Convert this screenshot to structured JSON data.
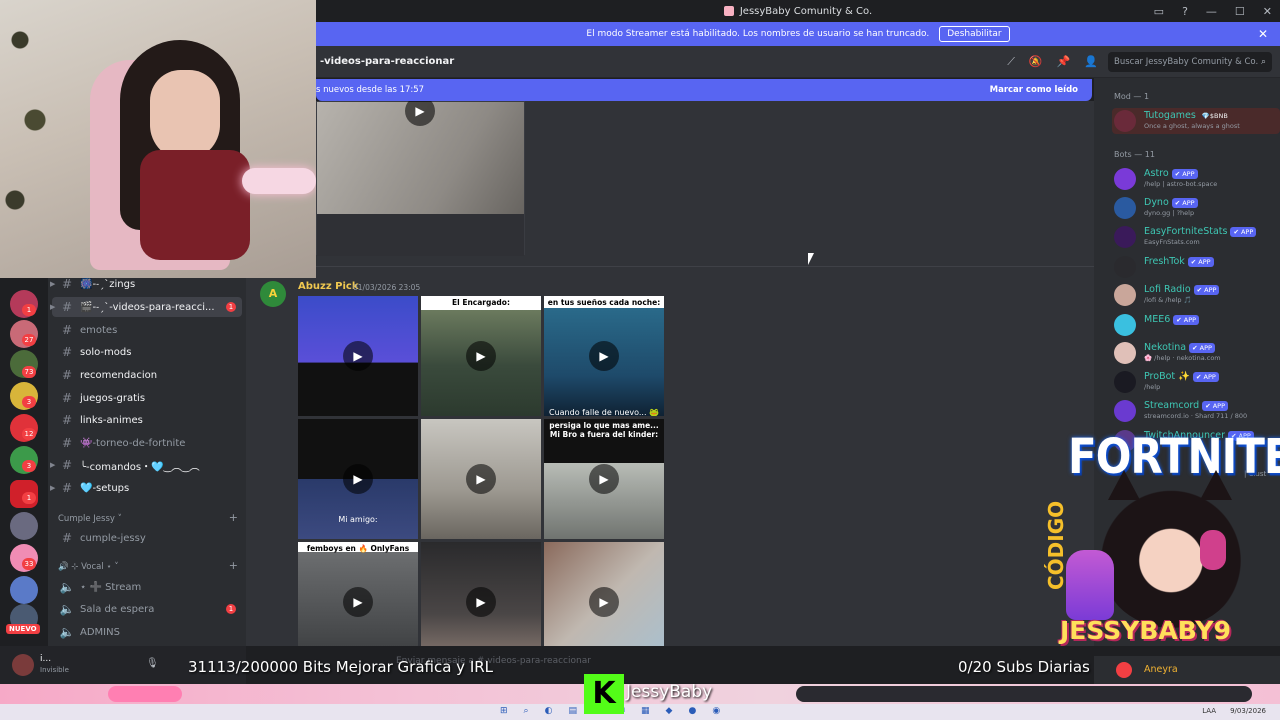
{
  "window": {
    "title": "JessyBaby Comunity & Co.",
    "controls": [
      "▭",
      "?",
      "—",
      "☐",
      "✕"
    ]
  },
  "streamer_bar": {
    "message": "El modo Streamer está habilitado. Los nombres de usuario se han truncado.",
    "button": "Deshabilitar",
    "close": "✕"
  },
  "channel_header": {
    "name": "-videos-para-reaccionar",
    "search_placeholder": "Buscar JessyBaby Comunity & Co."
  },
  "new_messages": {
    "text": "s nuevos desde las 17:57",
    "mark_read": "Marcar como leído"
  },
  "server_rail": {
    "badges": [
      "1",
      "27",
      "73",
      "3",
      "12",
      "3",
      "1",
      "33"
    ],
    "nuevo": "NUEVO"
  },
  "channels": [
    {
      "label": "🎆-˗ˏˋzings",
      "icon": "#"
    },
    {
      "label": "🎬-˗ˏˋ-videos-para-reacci...",
      "icon": "#",
      "unread": "1"
    },
    {
      "label": "emotes",
      "icon": "#"
    },
    {
      "label": "solo-mods",
      "icon": "#"
    },
    {
      "label": "recomendacion",
      "icon": "#"
    },
    {
      "label": "juegos-gratis",
      "icon": "#"
    },
    {
      "label": "links-animes",
      "icon": "#"
    },
    {
      "label": "👾-torneo-de-fortnite",
      "icon": "#"
    },
    {
      "label": "╰-comandos・🩵‿︵‿︵",
      "icon": "#"
    },
    {
      "label": "🩵-setups",
      "icon": "#"
    }
  ],
  "categories": {
    "cumple": "Cumple Jessy ˅",
    "cumple_channel": "cumple-jessy",
    "vocal": "🔊 ⊹ Vocal ⋆ ˅",
    "voice": [
      {
        "label": "⋆ ➕ Stream"
      },
      {
        "label": "Sala de espera",
        "unread": "1"
      },
      {
        "label": "ADMINS"
      }
    ]
  },
  "user_panel": {
    "name": "i...",
    "status": "Invisible"
  },
  "message": {
    "author": "Abuzz Pick",
    "timestamp": "01/03/2026 23:05",
    "avatar_letter": "A",
    "tiles": [
      {
        "caption": ""
      },
      {
        "caption": "El Encargado:"
      },
      {
        "caption": "en tus sueños cada noche:",
        "bottom": "Cuando falle de nuevo... 🐸"
      },
      {
        "caption": "",
        "mid": "Mi amigo:"
      },
      {
        "caption": ""
      },
      {
        "caption": "persiga lo que mas ame... Mi Bro a fuera del kinder:"
      },
      {
        "caption": "femboys en 🔥 OnlyFans"
      },
      {
        "caption": ""
      },
      {
        "caption": ""
      }
    ]
  },
  "input_placeholder": "Enviar mensaje a #-videos-para-reaccionar",
  "members": {
    "mod_group": "Mod — 1",
    "bots_group": "Bots — 11",
    "list": [
      {
        "name": "Tutogames",
        "tag": "💎$BNB",
        "sub": "Once a ghost, always a ghost",
        "color": "#3ec7b4"
      },
      {
        "name": "Astro",
        "tag": "✔ APP",
        "sub": "/help | astro-bot.space"
      },
      {
        "name": "Dyno",
        "tag": "✔ APP",
        "sub": "dyno.gg | ?help"
      },
      {
        "name": "EasyFortniteStats",
        "tag": "✔ APP",
        "sub": "EasyFnStats.com"
      },
      {
        "name": "FreshTok",
        "tag": "✔ APP",
        "sub": ""
      },
      {
        "name": "Lofi Radio",
        "tag": "✔ APP",
        "sub": "/lofi & /help 🎵"
      },
      {
        "name": "MEE6",
        "tag": "✔ APP",
        "sub": ""
      },
      {
        "name": "Nekotina",
        "tag": "✔ APP",
        "sub": "🌸 /help · nekotina.com"
      },
      {
        "name": "ProBot ✨",
        "tag": "✔ APP",
        "sub": "/help"
      },
      {
        "name": "Streamcord",
        "tag": "✔ APP",
        "sub": "streamcord.io · Shard 711 / 800"
      },
      {
        "name": "TwitchAnnouncer",
        "tag": "✔ APP",
        "sub": ""
      }
    ],
    "clust": "| Clust"
  },
  "overlay": {
    "fortnite": "FORTNITE",
    "codigo": "CÓDIGO",
    "code": "JESSYBABY9",
    "bits": "31113/200000 Bits Mejorar Grafica y IRL",
    "subs": "0/20 Subs Diarias",
    "kick_letter": "K",
    "kick_name": "JessyBaby",
    "aneyra": "Aneyra"
  },
  "taskbar": {
    "lang": "LAA",
    "date": "9/03/2026"
  }
}
